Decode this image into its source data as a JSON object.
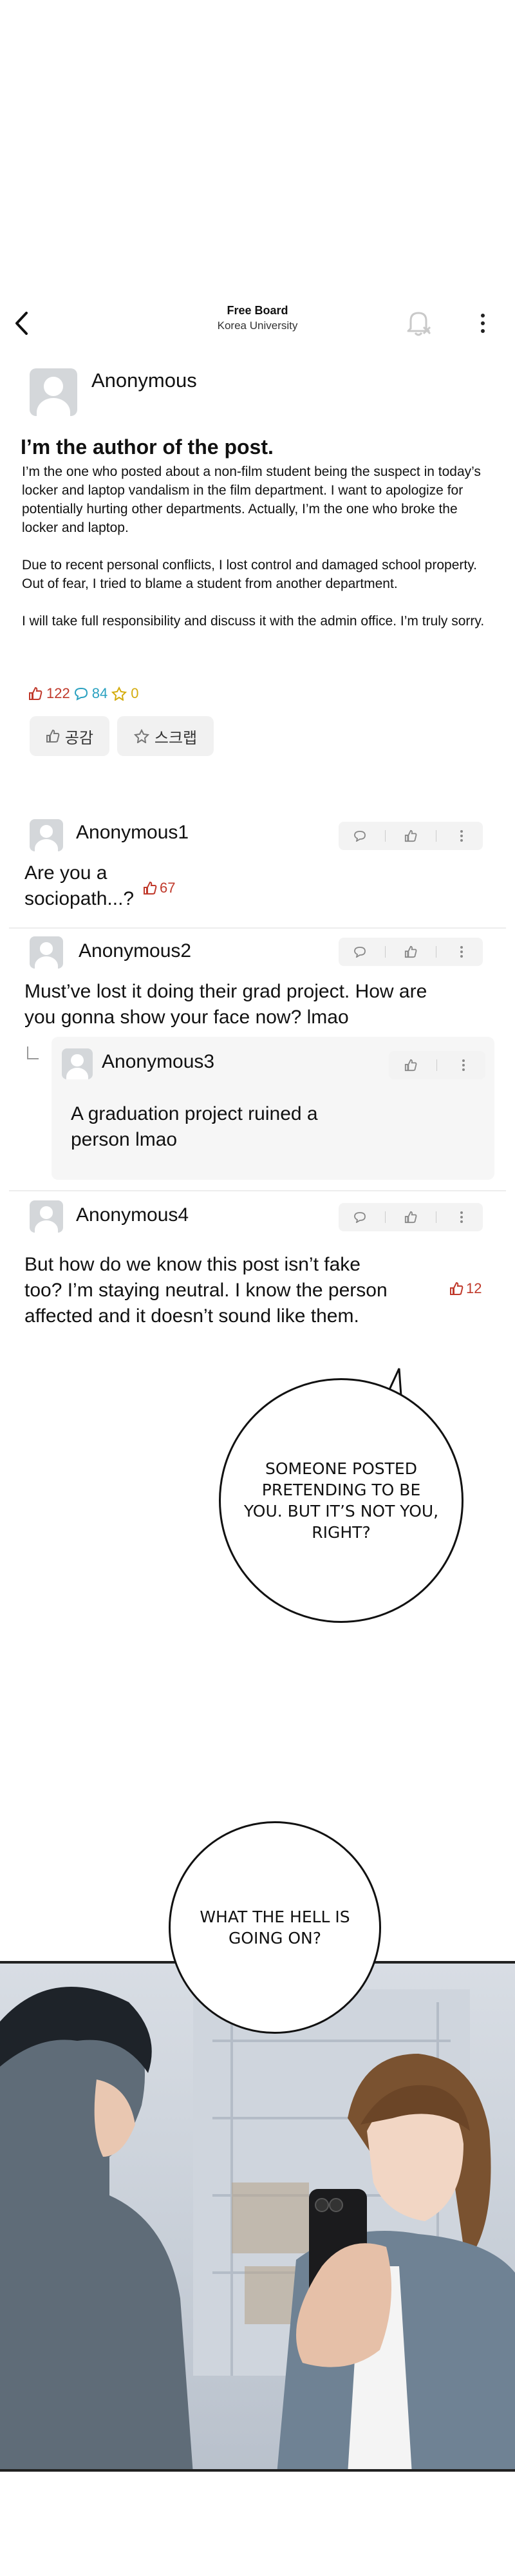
{
  "header": {
    "title": "Free Board",
    "subtitle": "Korea University",
    "back_icon": "chevron-left-icon",
    "bell_icon": "bell-off-icon",
    "more_icon": "more-vertical-icon"
  },
  "post": {
    "author": "Anonymous",
    "title": "I’m the author of the post.",
    "paragraphs": [
      "I’m the one who posted about a non-film student being the suspect in today’s locker and laptop vandalism in the film department. I want to apologize for potentially hurting other departments. Actually, I’m the one who broke the locker and laptop.",
      "Due to recent personal conflicts, I lost control and damaged school property. Out of fear, I tried to blame a student from another department.",
      "I will take full responsibility and discuss it with the admin office. I’m truly sorry."
    ],
    "likes": "122",
    "comments": "84",
    "scraps": "0",
    "like_button": "공감",
    "scrap_button": "스크랩"
  },
  "comments": [
    {
      "author": "Anonymous1",
      "text_lines": [
        "Are you a",
        "sociopath...?"
      ],
      "likes": "67"
    },
    {
      "author": "Anonymous2",
      "text_lines": [
        "Must’ve lost it doing their grad project. How are",
        "you gonna show your face now? lmao"
      ]
    },
    {
      "author": "Anonymous3",
      "text_lines": [
        "A graduation project ruined a",
        "person lmao"
      ]
    },
    {
      "author": "Anonymous4",
      "text_lines": [
        "But how do we know this post isn’t fake",
        "too? I’m staying neutral. I know the person",
        "affected and it doesn’t sound like them."
      ],
      "likes": "12"
    }
  ],
  "comic": {
    "bubble1_lines": [
      "SOMEONE POSTED",
      "PRETENDING TO BE",
      "YOU. BUT IT’S NOT YOU,",
      "RIGHT?"
    ],
    "bubble2_lines": [
      "WHAT THE HELL IS",
      "GOING ON?"
    ]
  },
  "colors": {
    "like": "#c0392b",
    "comment": "#2aa1c0",
    "scrap": "#d4ac0d",
    "avatar_bg": "#d4d7da"
  }
}
